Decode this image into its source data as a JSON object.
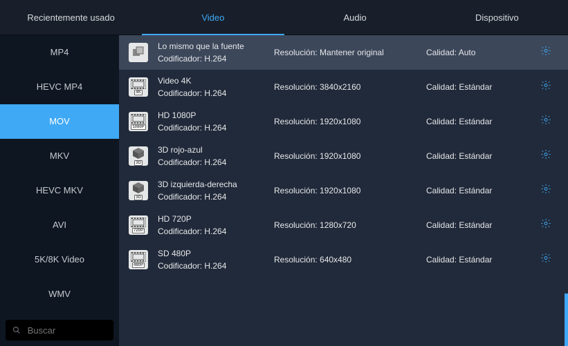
{
  "top_tabs": {
    "recent": "Recientemente usado",
    "video": "Video",
    "audio": "Audio",
    "device": "Dispositivo",
    "activeIndex": 1
  },
  "sidebar": {
    "items": [
      "MP4",
      "HEVC MP4",
      "MOV",
      "MKV",
      "HEVC MKV",
      "AVI",
      "5K/8K Video",
      "WMV"
    ],
    "activeIndex": 2
  },
  "search": {
    "placeholder": "Buscar"
  },
  "labels": {
    "encoder": "Codificador:",
    "resolution": "Resolución:",
    "quality": "Calidad:"
  },
  "profiles": [
    {
      "title": "Lo mismo que la fuente",
      "encoder": "H.264",
      "resolution": "Mantener original",
      "quality": "Auto",
      "badge": "",
      "active": true
    },
    {
      "title": "Video 4K",
      "encoder": "H.264",
      "resolution": "3840x2160",
      "quality": "Estándar",
      "badge": "4K",
      "active": false
    },
    {
      "title": "HD 1080P",
      "encoder": "H.264",
      "resolution": "1920x1080",
      "quality": "Estándar",
      "badge": "1080P",
      "active": false
    },
    {
      "title": "3D rojo-azul",
      "encoder": "H.264",
      "resolution": "1920x1080",
      "quality": "Estándar",
      "badge": "3D",
      "active": false
    },
    {
      "title": "3D izquierda-derecha",
      "encoder": "H.264",
      "resolution": "1920x1080",
      "quality": "Estándar",
      "badge": "3D",
      "active": false
    },
    {
      "title": "HD 720P",
      "encoder": "H.264",
      "resolution": "1280x720",
      "quality": "Estándar",
      "badge": "720P",
      "active": false
    },
    {
      "title": "SD 480P",
      "encoder": "H.264",
      "resolution": "640x480",
      "quality": "Estándar",
      "badge": "480P",
      "active": false
    }
  ]
}
